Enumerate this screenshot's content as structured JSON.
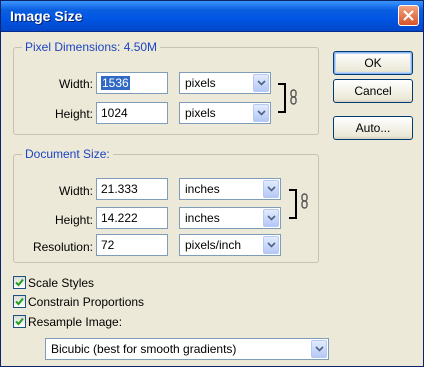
{
  "window": {
    "title": "Image Size"
  },
  "pixel_dimensions": {
    "title": "Pixel Dimensions:  4.50M",
    "width_label": "Width:",
    "width_value": "1536",
    "width_unit": "pixels",
    "height_label": "Height:",
    "height_value": "1024",
    "height_unit": "pixels"
  },
  "document_size": {
    "title": "Document Size:",
    "width_label": "Width:",
    "width_value": "21.333",
    "width_unit": "inches",
    "height_label": "Height:",
    "height_value": "14.222",
    "height_unit": "inches",
    "resolution_label": "Resolution:",
    "resolution_value": "72",
    "resolution_unit": "pixels/inch"
  },
  "buttons": {
    "ok": "OK",
    "cancel": "Cancel",
    "auto": "Auto..."
  },
  "options": {
    "scale_styles": {
      "label": "Scale Styles",
      "checked": true
    },
    "constrain_proportions": {
      "label": "Constrain Proportions",
      "checked": true
    },
    "resample_image": {
      "label": "Resample Image:",
      "checked": true
    },
    "resample_method": "Bicubic (best for smooth gradients)"
  },
  "colors": {
    "titlebar": "#0055e5",
    "group_title": "#1d44c4",
    "selection": "#316ac5",
    "dialog_bg": "#ece9d8"
  }
}
